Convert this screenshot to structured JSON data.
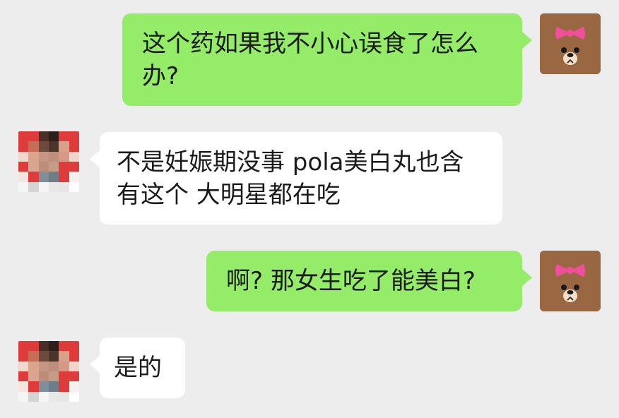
{
  "conversation": {
    "messages": [
      {
        "sender": "me",
        "text": "这个药如果我不小心误食了怎么办?"
      },
      {
        "sender": "them",
        "text": "不是妊娠期没事 pola美白丸也含有这个 大明星都在吃"
      },
      {
        "sender": "me",
        "text": "啊? 那女生吃了能美白?"
      },
      {
        "sender": "them",
        "text": "是的"
      }
    ]
  },
  "avatars": {
    "me": {
      "icon": "brown-bear-with-pink-bow-icon",
      "bg": "#9a6743",
      "bow": "#f0509b"
    },
    "them": {
      "icon": "pixelated-profile-photo",
      "bg": "#e03b3b"
    }
  },
  "colors": {
    "background": "#ededed",
    "my_bubble": "#95ec69",
    "their_bubble": "#ffffff",
    "text": "#1b1b1b"
  }
}
